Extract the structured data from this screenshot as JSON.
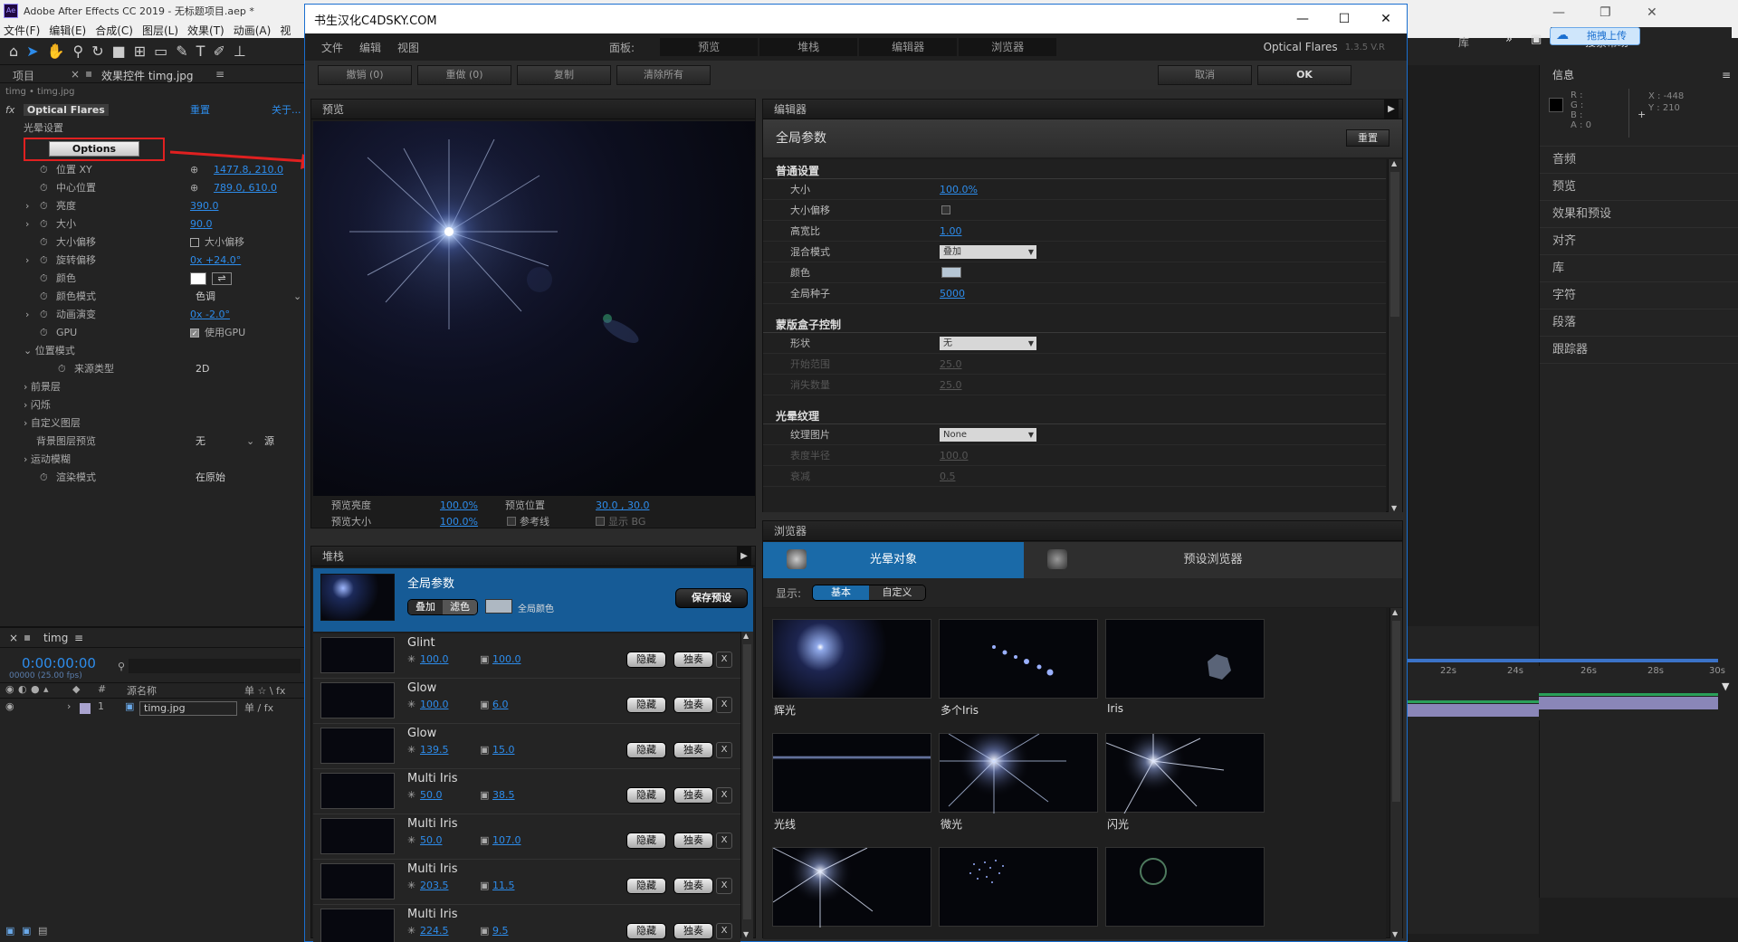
{
  "ae": {
    "title": "Adobe After Effects CC 2019 - 无标题项目.aep *",
    "logo": "Ae",
    "menu": [
      "文件(F)",
      "编辑(E)",
      "合成(C)",
      "图层(L)",
      "效果(T)",
      "动画(A)",
      "视"
    ],
    "tabs": {
      "project": "项目",
      "effects": "效果控件 timg.jpg"
    },
    "breadcrumb": "timg • timg.jpg",
    "right_top": {
      "upload": "拖拽上传",
      "search": "搜索帮助",
      "lib": "库"
    },
    "info_panel": {
      "title": "信息",
      "r": "R :",
      "g": "G :",
      "b": "B :",
      "a": "A : 0",
      "x": "X : -448",
      "y": "Y : 210"
    },
    "right_items": [
      "音频",
      "预览",
      "效果和预设",
      "对齐",
      "库",
      "字符",
      "段落",
      "跟踪器"
    ],
    "timeline": {
      "tab": "timg",
      "timecode": "0:00:00:00",
      "fps": "00000 (25.00 fps)",
      "col_src": "源名称",
      "layer_num": "1",
      "layer_name": "timg.jpg",
      "ticks": [
        "22s",
        "24s",
        "26s",
        "28s",
        "30s"
      ]
    }
  },
  "effect_panel": {
    "plugin": "Optical Flares",
    "reset": "重置",
    "about": "关于...",
    "group_flare": "光晕设置",
    "options_button": "Options",
    "rows": [
      {
        "label": "位置 XY",
        "value": "1477.8, 210.0"
      },
      {
        "label": "中心位置",
        "value": "789.0, 610.0"
      },
      {
        "label": "亮度",
        "value": "390.0"
      },
      {
        "label": "大小",
        "value": "90.0"
      },
      {
        "label": "大小偏移",
        "value": "大小偏移"
      },
      {
        "label": "旋转偏移",
        "value": "0x +24.0°"
      },
      {
        "label": "颜色",
        "value": ""
      },
      {
        "label": "颜色模式",
        "value": "色调"
      },
      {
        "label": "动画演变",
        "value": "0x -2.0°"
      },
      {
        "label": "GPU",
        "value": "使用GPU"
      }
    ],
    "group_pos": "位置模式",
    "source_type_label": "来源类型",
    "source_type_value": "2D",
    "groups": [
      "前景层",
      "闪烁",
      "自定义图层"
    ],
    "bg_preview_label": "背景图层预览",
    "bg_preview_value": "无",
    "bg_source": "源",
    "motion_blur": "运动模糊",
    "render_mode_label": "渲染模式",
    "render_mode_value": "在原始"
  },
  "of": {
    "title": "书生汉化C4DSKY.COM",
    "version_label": "Optical Flares",
    "version": "1.3.5 V.R",
    "menu": [
      "文件",
      "编辑",
      "视图"
    ],
    "panels_label": "面板:",
    "panel_tabs": [
      "预览",
      "堆栈",
      "编辑器",
      "浏览器"
    ],
    "actions": {
      "undo": "撤销 (0)",
      "redo": "重做 (0)",
      "copy": "复制",
      "clear": "清除所有",
      "cancel": "取消",
      "ok": "OK"
    },
    "preview": {
      "title": "预览",
      "brightness_label": "预览亮度",
      "brightness_value": "100.0%",
      "size_label": "预览大小",
      "size_value": "100.0%",
      "pos_label": "预览位置",
      "pos_value": "30.0 , 30.0",
      "ref_label": "参考线",
      "bg_label": "显示 BG"
    },
    "editor": {
      "title": "编辑器",
      "sub_title": "全局参数",
      "reset": "重置",
      "sections": [
        {
          "name": "普通设置",
          "rows": [
            {
              "label": "大小",
              "type": "val",
              "value": "100.0%"
            },
            {
              "label": "大小偏移",
              "type": "check",
              "value": ""
            },
            {
              "label": "高宽比",
              "type": "val",
              "value": "1.00"
            },
            {
              "label": "混合模式",
              "type": "select",
              "value": "叠加"
            },
            {
              "label": "颜色",
              "type": "swatch",
              "value": ""
            },
            {
              "label": "全局种子",
              "type": "val",
              "value": "5000"
            }
          ]
        },
        {
          "name": "蒙版盒子控制",
          "rows": [
            {
              "label": "形状",
              "type": "select",
              "value": "无"
            },
            {
              "label": "开始范围",
              "type": "dim",
              "value": "25.0"
            },
            {
              "label": "消失数量",
              "type": "dim",
              "value": "25.0"
            }
          ]
        },
        {
          "name": "光晕纹理",
          "rows": [
            {
              "label": "纹理图片",
              "type": "select",
              "value": "None"
            },
            {
              "label": "表度半径",
              "type": "dim",
              "value": "100.0"
            },
            {
              "label": "衰减",
              "type": "dim",
              "value": "0.5"
            }
          ]
        }
      ]
    },
    "stack": {
      "title": "堆栈",
      "global_title": "全局参数",
      "blend_add": "叠加",
      "blend_screen": "滤色",
      "global_color": "全局颜色",
      "save_preset": "保存预设",
      "hide": "隐藏",
      "solo": "独奏",
      "close": "X",
      "items": [
        {
          "name": "Glint",
          "v1": "100.0",
          "v2": "100.0"
        },
        {
          "name": "Glow",
          "v1": "100.0",
          "v2": "6.0"
        },
        {
          "name": "Glow",
          "v1": "139.5",
          "v2": "15.0"
        },
        {
          "name": "Multi Iris",
          "v1": "50.0",
          "v2": "38.5"
        },
        {
          "name": "Multi Iris",
          "v1": "50.0",
          "v2": "107.0"
        },
        {
          "name": "Multi Iris",
          "v1": "203.5",
          "v2": "11.5"
        },
        {
          "name": "Multi Iris",
          "v1": "224.5",
          "v2": "9.5"
        }
      ]
    },
    "browser": {
      "title": "浏览器",
      "tab_objects": "光晕对象",
      "tab_presets": "预设浏览器",
      "display_label": "显示:",
      "mode_basic": "基本",
      "mode_custom": "自定义",
      "cells": [
        "辉光",
        "多个Iris",
        "Iris",
        "光线",
        "微光",
        "闪光",
        "",
        "",
        ""
      ]
    }
  }
}
